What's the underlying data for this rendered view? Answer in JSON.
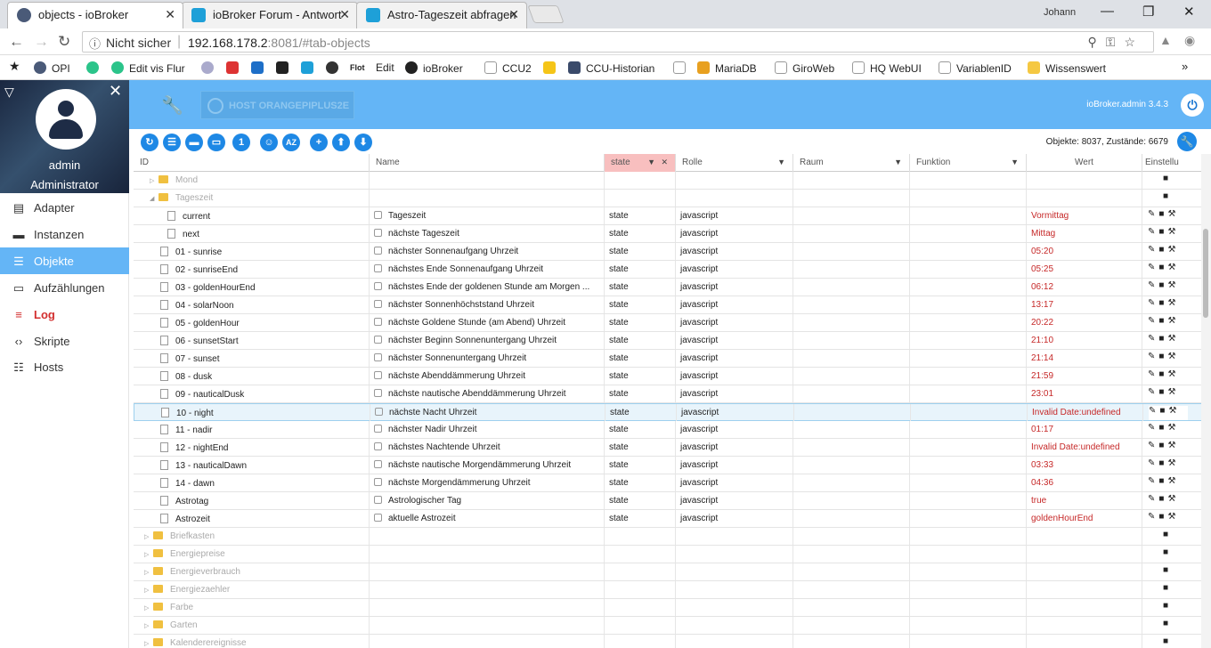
{
  "browser": {
    "tabs": [
      {
        "title": "objects - ioBroker",
        "icon_color": "#4a5a78"
      },
      {
        "title": "ioBroker Forum - Antwort",
        "icon_color": "#1ea0d8"
      },
      {
        "title": "Astro-Tageszeit abfragen",
        "icon_color": "#1ea0d8"
      }
    ],
    "user": "Johann",
    "url_security": "Nicht sicher",
    "url_host": "192.168.178.2",
    "url_rest": ":8081/#tab-objects",
    "bookmarks": [
      "OPI",
      "Edit vis Flur",
      "Flot",
      "Edit",
      "ioBroker",
      "CCU2",
      "CCU-Historian",
      "MariaDB",
      "GiroWeb",
      "HQ WebUI",
      "VariablenID",
      "Wissenswert"
    ],
    "bookmarks_more": "»"
  },
  "sidebar": {
    "user": "admin",
    "role": "Administrator",
    "items": [
      {
        "label": "Adapter",
        "icon": "adapter-icon"
      },
      {
        "label": "Instanzen",
        "icon": "instances-icon"
      },
      {
        "label": "Objekte",
        "icon": "objects-icon"
      },
      {
        "label": "Aufzählungen",
        "icon": "enums-icon"
      },
      {
        "label": "Log",
        "icon": "log-icon"
      },
      {
        "label": "Skripte",
        "icon": "scripts-icon"
      },
      {
        "label": "Hosts",
        "icon": "hosts-icon"
      }
    ]
  },
  "header": {
    "host": "HOST ORANGEPIPLUS2E",
    "version": "ioBroker.admin 3.4.3"
  },
  "toolbar": {
    "counts": "Objekte: 8037, Zustände: 6679",
    "one_label": "1",
    "az_label": "AZ"
  },
  "table": {
    "columns": {
      "id": "ID",
      "name": "Name",
      "type": "state",
      "role": "Rolle",
      "room": "Raum",
      "function": "Funktion",
      "value": "Wert",
      "settings": "Einstellu"
    },
    "rows": [
      {
        "id": "Mond",
        "kind": "folder",
        "level": 1,
        "expand": "▷",
        "name": "",
        "type": "",
        "role": "",
        "value": ""
      },
      {
        "id": "Tageszeit",
        "kind": "folder",
        "level": 1,
        "expand": "◢",
        "name": "",
        "type": "",
        "role": "",
        "value": ""
      },
      {
        "id": "current",
        "kind": "file",
        "level": 2,
        "name": "Tageszeit",
        "type": "state",
        "role": "javascript",
        "value": "Vormittag"
      },
      {
        "id": "next",
        "kind": "file",
        "level": 2,
        "name": "nächste Tageszeit",
        "type": "state",
        "role": "javascript",
        "value": "Mittag"
      },
      {
        "id": "01 - sunrise",
        "kind": "file",
        "level": 1,
        "name": "nächster Sonnenaufgang Uhrzeit",
        "type": "state",
        "role": "javascript",
        "value": "05:20"
      },
      {
        "id": "02 - sunriseEnd",
        "kind": "file",
        "level": 1,
        "name": "nächstes Ende Sonnenaufgang Uhrzeit",
        "type": "state",
        "role": "javascript",
        "value": "05:25"
      },
      {
        "id": "03 - goldenHourEnd",
        "kind": "file",
        "level": 1,
        "name": "nächstes Ende der goldenen Stunde am Morgen ...",
        "type": "state",
        "role": "javascript",
        "value": "06:12"
      },
      {
        "id": "04 - solarNoon",
        "kind": "file",
        "level": 1,
        "name": "nächster Sonnenhöchststand Uhrzeit",
        "type": "state",
        "role": "javascript",
        "value": "13:17"
      },
      {
        "id": "05 - goldenHour",
        "kind": "file",
        "level": 1,
        "name": "nächste Goldene Stunde (am Abend) Uhrzeit",
        "type": "state",
        "role": "javascript",
        "value": "20:22"
      },
      {
        "id": "06 - sunsetStart",
        "kind": "file",
        "level": 1,
        "name": "nächster Beginn Sonnenuntergang Uhrzeit",
        "type": "state",
        "role": "javascript",
        "value": "21:10"
      },
      {
        "id": "07 - sunset",
        "kind": "file",
        "level": 1,
        "name": "nächster Sonnenuntergang Uhrzeit",
        "type": "state",
        "role": "javascript",
        "value": "21:14"
      },
      {
        "id": "08 - dusk",
        "kind": "file",
        "level": 1,
        "name": "nächste Abenddämmerung Uhrzeit",
        "type": "state",
        "role": "javascript",
        "value": "21:59"
      },
      {
        "id": "09 - nauticalDusk",
        "kind": "file",
        "level": 1,
        "name": "nächste nautische Abenddämmerung Uhrzeit",
        "type": "state",
        "role": "javascript",
        "value": "23:01"
      },
      {
        "id": "10 - night",
        "kind": "file",
        "level": 1,
        "name": "nächste Nacht Uhrzeit",
        "type": "state",
        "role": "javascript",
        "value": "Invalid Date:undefined",
        "selected": true
      },
      {
        "id": "11 - nadir",
        "kind": "file",
        "level": 1,
        "name": "nächster Nadir Uhrzeit",
        "type": "state",
        "role": "javascript",
        "value": "01:17"
      },
      {
        "id": "12 - nightEnd",
        "kind": "file",
        "level": 1,
        "name": "nächstes Nachtende Uhrzeit",
        "type": "state",
        "role": "javascript",
        "value": "Invalid Date:undefined"
      },
      {
        "id": "13 - nauticalDawn",
        "kind": "file",
        "level": 1,
        "name": "nächste nautische Morgendämmerung Uhrzeit",
        "type": "state",
        "role": "javascript",
        "value": "03:33"
      },
      {
        "id": "14 - dawn",
        "kind": "file",
        "level": 1,
        "name": "nächste Morgendämmerung Uhrzeit",
        "type": "state",
        "role": "javascript",
        "value": "04:36"
      },
      {
        "id": "Astrotag",
        "kind": "file",
        "level": 1,
        "name": "Astrologischer Tag",
        "type": "state",
        "role": "javascript",
        "value": "true"
      },
      {
        "id": "Astrozeit",
        "kind": "file",
        "level": 1,
        "name": "aktuelle Astrozeit",
        "type": "state",
        "role": "javascript",
        "value": "goldenHourEnd"
      },
      {
        "id": "Briefkasten",
        "kind": "folder",
        "level": 0,
        "expand": "▷",
        "name": "",
        "type": "",
        "role": "",
        "value": ""
      },
      {
        "id": "Energiepreise",
        "kind": "folder",
        "level": 0,
        "expand": "▷",
        "name": "",
        "type": "",
        "role": "",
        "value": ""
      },
      {
        "id": "Energieverbrauch",
        "kind": "folder",
        "level": 0,
        "expand": "▷",
        "name": "",
        "type": "",
        "role": "",
        "value": ""
      },
      {
        "id": "Energiezaehler",
        "kind": "folder",
        "level": 0,
        "expand": "▷",
        "name": "",
        "type": "",
        "role": "",
        "value": ""
      },
      {
        "id": "Farbe",
        "kind": "folder",
        "level": 0,
        "expand": "▷",
        "name": "",
        "type": "",
        "role": "",
        "value": ""
      },
      {
        "id": "Garten",
        "kind": "folder",
        "level": 0,
        "expand": "▷",
        "name": "",
        "type": "",
        "role": "",
        "value": ""
      },
      {
        "id": "Kalenderereignisse",
        "kind": "folder",
        "level": 0,
        "expand": "▷",
        "name": "",
        "type": "",
        "role": "",
        "value": ""
      }
    ]
  }
}
